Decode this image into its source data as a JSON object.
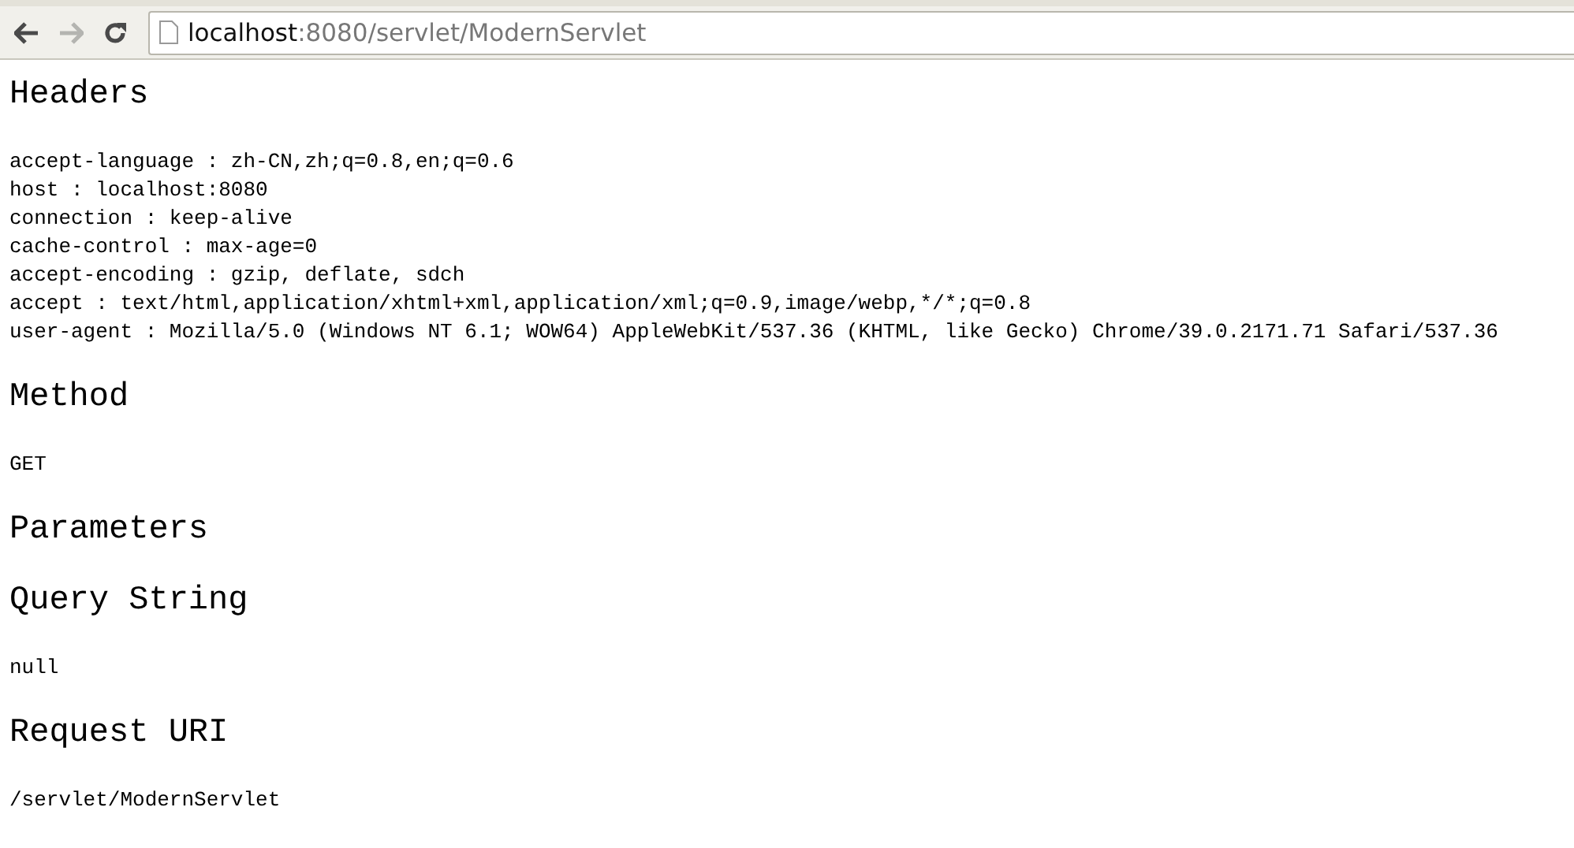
{
  "toolbar": {
    "back": {
      "disabled": false
    },
    "forward": {
      "disabled": true
    },
    "address": {
      "host": "localhost",
      "rest": ":8080/servlet/ModernServlet"
    }
  },
  "sections": [
    {
      "heading": "Headers",
      "lines": [
        "accept-language : zh-CN,zh;q=0.8,en;q=0.6",
        "host : localhost:8080",
        "connection : keep-alive",
        "cache-control : max-age=0",
        "accept-encoding : gzip, deflate, sdch",
        "accept : text/html,application/xhtml+xml,application/xml;q=0.9,image/webp,*/*;q=0.8",
        "user-agent : Mozilla/5.0 (Windows NT 6.1; WOW64) AppleWebKit/537.36 (KHTML, like Gecko) Chrome/39.0.2171.71 Safari/537.36"
      ]
    },
    {
      "heading": "Method",
      "lines": [
        "GET"
      ]
    },
    {
      "heading": "Parameters"
    },
    {
      "heading": "Query String",
      "lines": [
        "null"
      ]
    },
    {
      "heading": "Request URI",
      "lines": [
        "/servlet/ModernServlet"
      ]
    }
  ]
}
